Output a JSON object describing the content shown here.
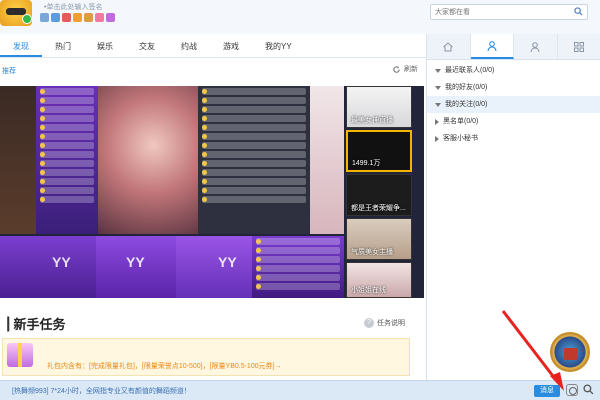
{
  "header": {
    "signature_placeholder": "•单击此处输入签名",
    "search_placeholder": "大家都在看"
  },
  "nav": {
    "tabs": [
      "发现",
      "热门",
      "娱乐",
      "交友",
      "约战",
      "游戏",
      "我的YY"
    ]
  },
  "sub": {
    "link": "推荐",
    "refresh": "刷新"
  },
  "live_cards": [
    {
      "caption": "最美女神直播"
    },
    {
      "caption": "1499.1万"
    },
    {
      "caption": "都是王者荣耀争..."
    },
    {
      "caption": "气质美女主播"
    },
    {
      "caption": "小姐姐在线"
    }
  ],
  "tiles": {
    "brand": "YY"
  },
  "task": {
    "lead": "|",
    "title": "新手任务",
    "help": "任务说明",
    "gift_text": "礼包内含有：[完成限量礼包]，[限量荣誉点10-500]，[限量YB0.5-100元券]→"
  },
  "status": {
    "text": "[热舞频993] 7*24小时，全网指专业又有颜值的舞蹈频道！",
    "button": "消息"
  },
  "right_panel": {
    "groups": [
      {
        "label": "最近联系人(0/0)",
        "expanded": true
      },
      {
        "label": "我的好友(0/0)",
        "expanded": true
      },
      {
        "label": "我的关注(0/0)",
        "expanded": true,
        "selected": true
      },
      {
        "label": "黑名单(0/0)",
        "expanded": false
      },
      {
        "label": "客服小秘书",
        "expanded": false
      }
    ]
  },
  "colors": {
    "accent": "#2a8ce0",
    "status_bar": "#dbe9f7",
    "gift_text": "#e8891a",
    "arrow": "#e8231f"
  }
}
